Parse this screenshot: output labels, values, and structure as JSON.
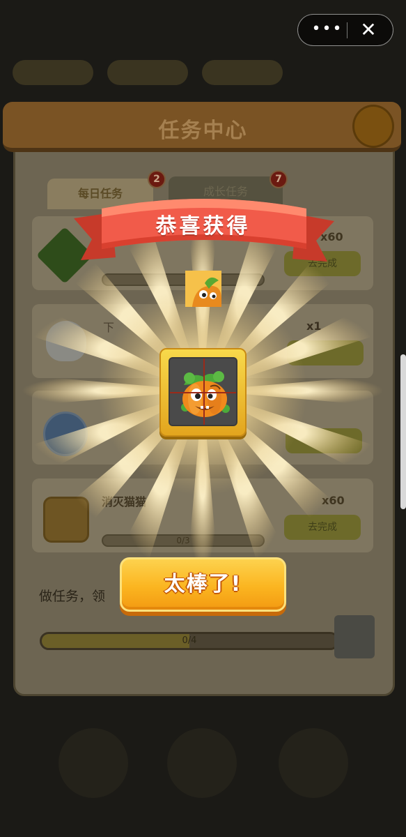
{
  "capsule": {
    "more_icon": "more-dots-icon",
    "close_icon": "close-icon",
    "more_label": "•••",
    "close_label": "✕"
  },
  "background": {
    "title": "任务中心",
    "tabs": [
      {
        "label": "每日任务",
        "badge": "2"
      },
      {
        "label": "成长任务",
        "badge": "7"
      }
    ],
    "tasks": [
      {
        "reward": "x60",
        "button": "去完成"
      },
      {
        "title": "下",
        "reward": "x1",
        "button": ""
      },
      {
        "reward": "",
        "button": ""
      },
      {
        "title": "消灭猫猫",
        "reward": "x60",
        "button": "去完成",
        "progress": "0/3"
      }
    ],
    "hint": "做任务，领",
    "progress_text": "0/4"
  },
  "popup": {
    "banner": "恭喜获得",
    "item": "pumpkin-monster",
    "button": "太棒了!"
  },
  "colors": {
    "button_orange": "#fbb520",
    "ribbon_red": "#f0584a",
    "frame_gold": "#f3c232"
  }
}
